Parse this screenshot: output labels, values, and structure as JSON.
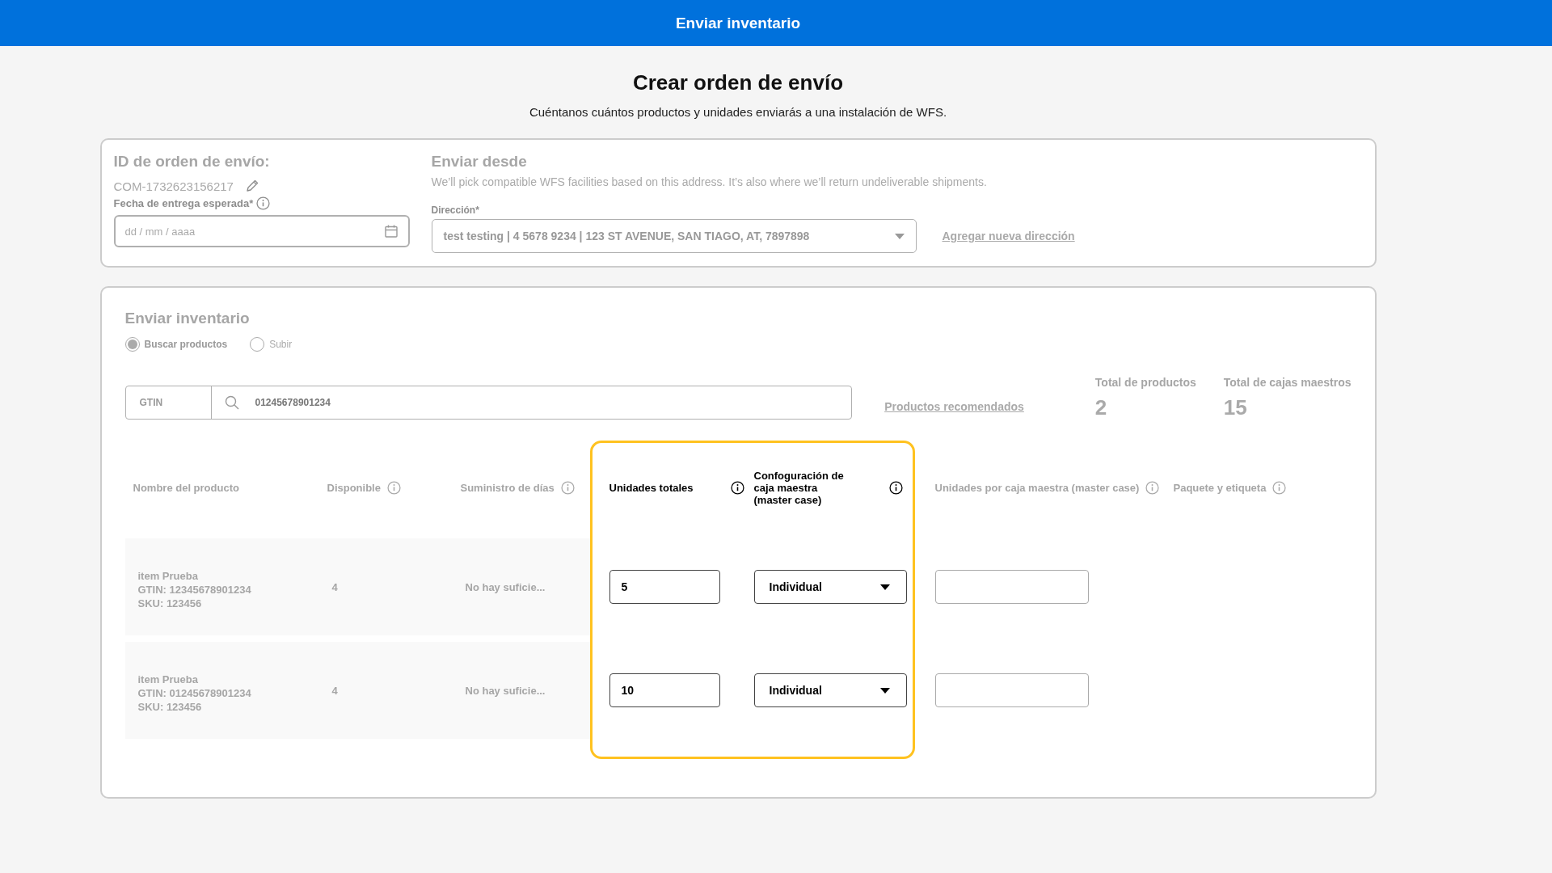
{
  "header": {
    "title": "Enviar inventario"
  },
  "page": {
    "title": "Crear orden de envío",
    "subtitle": "Cuéntanos cuántos productos y unidades enviarás a una instalación de WFS."
  },
  "order": {
    "id_label": "ID de orden de envío:",
    "id": "COM-1732623156217",
    "date_label": "Fecha de entrega esperada*",
    "date_placeholder": "dd / mm / aaaa"
  },
  "ship_from": {
    "title": "Enviar desde",
    "description": "We’ll pick compatible WFS facilities based on this address. It’s also where we’ll return undeliverable shipments.",
    "address_label": "Dirección*",
    "address": "test testing | 4 5678 9234 | 123 ST AVENUE, SAN TIAGO, AT, 7897898",
    "add_link": "Agregar nueva dirección"
  },
  "inventory": {
    "title": "Enviar inventario",
    "modes": [
      {
        "label": "Buscar productos",
        "selected": true
      },
      {
        "label": "Subir",
        "selected": false
      }
    ],
    "search": {
      "type": "GTIN",
      "value": "01245678901234"
    },
    "recommended_link": "Productos recomendados",
    "totals": [
      {
        "label": "Total de productos",
        "value": "2"
      },
      {
        "label": "Total de cajas maestros",
        "value": "15"
      }
    ]
  },
  "table": {
    "columns": [
      {
        "label": "Nombre del producto",
        "info": false,
        "highlighted": false
      },
      {
        "label": "Disponible",
        "info": true,
        "highlighted": false
      },
      {
        "label": "Suministro de días",
        "info": true,
        "highlighted": false
      },
      {
        "label": "Unidades totales",
        "info": true,
        "highlighted": true
      },
      {
        "label": "Confoguración de caja maestra (master case)",
        "info": true,
        "highlighted": true
      },
      {
        "label": "Unidades por caja maestra (master case)",
        "info": true,
        "highlighted": false
      },
      {
        "label": "Paquete y etiqueta",
        "info": true,
        "highlighted": false
      }
    ],
    "rows": [
      {
        "cells": [
          {
            "kind": "product",
            "lines": [
              "item Prueba",
              "GTIN: 12345678901234",
              "SKU: 123456"
            ]
          },
          {
            "kind": "text",
            "text": "4"
          },
          {
            "kind": "text",
            "text": "No hay suficie..."
          },
          {
            "kind": "input",
            "value": "5"
          },
          {
            "kind": "select",
            "value": "Individual"
          },
          {
            "kind": "input"
          }
        ]
      },
      {
        "cells": [
          {
            "kind": "product",
            "lines": [
              "item Prueba",
              "GTIN: 01245678901234",
              "SKU: 123456"
            ]
          },
          {
            "kind": "text",
            "text": "4"
          },
          {
            "kind": "text",
            "text": "No hay suficie..."
          },
          {
            "kind": "input",
            "value": "10"
          },
          {
            "kind": "select",
            "value": "Individual"
          },
          {
            "kind": "input"
          }
        ]
      }
    ]
  }
}
